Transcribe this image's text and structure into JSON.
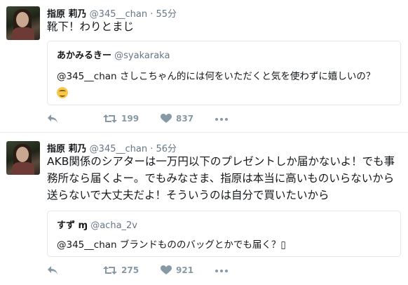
{
  "tweets": [
    {
      "name": "指原 莉乃",
      "handle": "@345__chan",
      "time": "· 55分",
      "text": "靴下！わりとまじ",
      "quote": {
        "name": "あかみるきー",
        "handle": "@syakaraka",
        "text": "@345__chan さしこちゃん的には何をいただくと気を使わずに嬉しいの？"
      },
      "retweets": "199",
      "likes": "837"
    },
    {
      "name": "指原 莉乃",
      "handle": "@345__chan",
      "time": "· 56分",
      "text": "AKB関係のシアターは一万円以下のプレゼントしか届かないよ！でも事務所なら届くよー。でもみなさま、指原は本当に高いものいらないから送らないで大丈夫だよ！そういうのは自分で買いたいから",
      "quote": {
        "name": "すず ɱ",
        "handle": "@acha_2v",
        "text": "@345__chan ブランドもののバッグとかでも届く？▯"
      },
      "retweets": "275",
      "likes": "921"
    }
  ],
  "colors": {
    "accent_text": "#657786",
    "icon": "#8899a6",
    "border": "#e1e8ed"
  },
  "icons": [
    "reply-icon",
    "retweet-icon",
    "heart-icon",
    "more-icon"
  ]
}
